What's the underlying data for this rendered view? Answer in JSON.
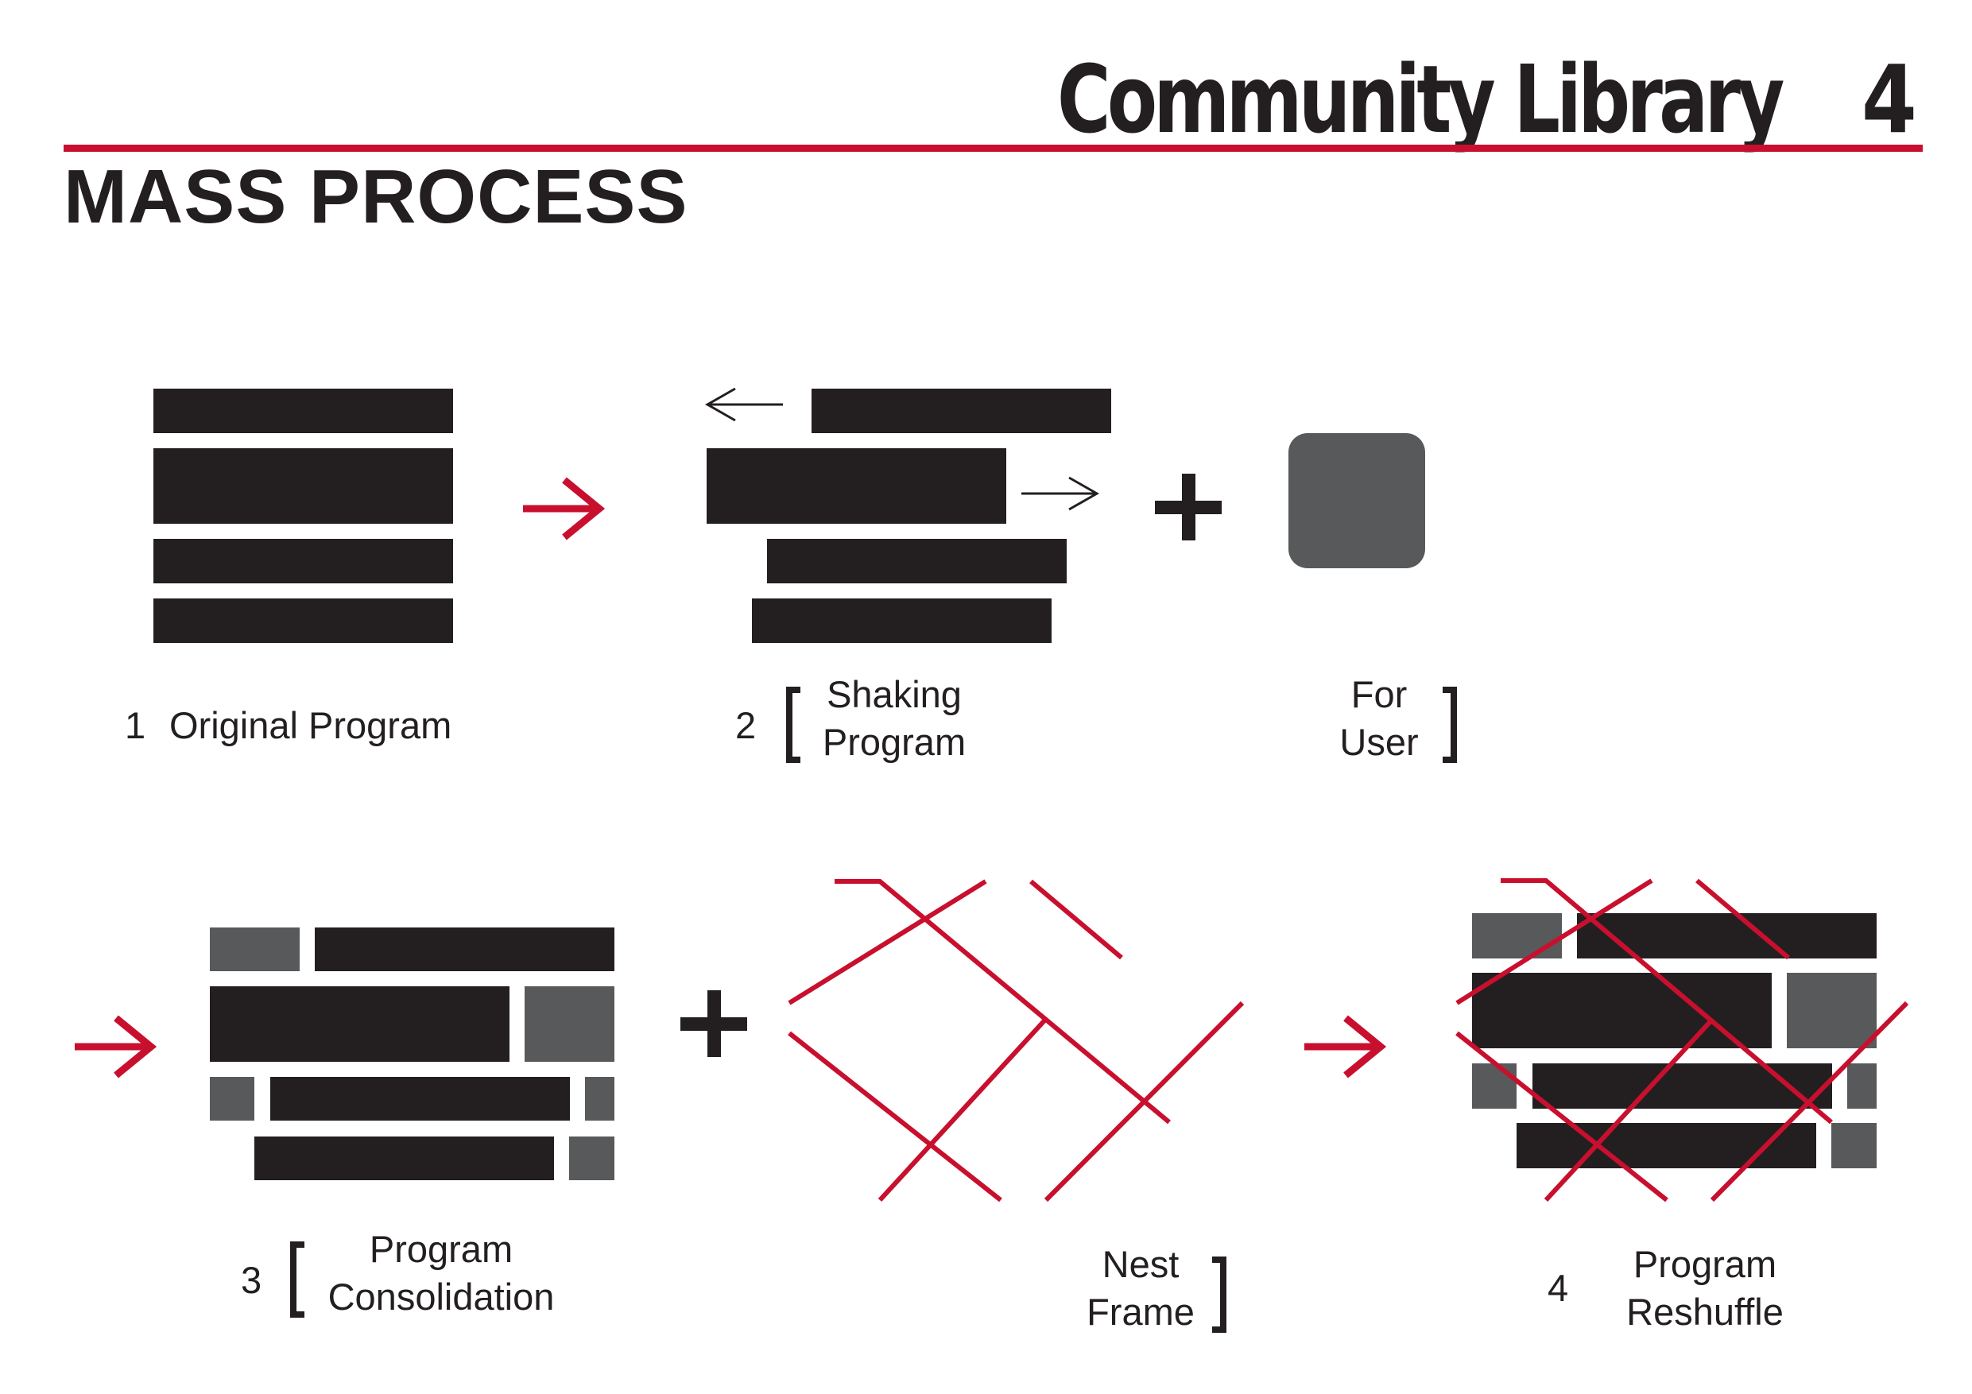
{
  "header": {
    "title": "Community Library",
    "page_number": "4"
  },
  "section_title": "MASS PROCESS",
  "colors": {
    "accent": "#c8102e",
    "program": "#231f20",
    "user": "#58595b",
    "background": "#ffffff"
  },
  "steps": [
    {
      "number": "1",
      "label": "Original Program"
    },
    {
      "number": "2",
      "label_line1": "Shaking",
      "label_line2": "Program"
    },
    {
      "label_line1": "For",
      "label_line2": "User"
    },
    {
      "number": "3",
      "label_line1": "Program",
      "label_line2": "Consolidation"
    },
    {
      "label_line1": "Nest",
      "label_line2": "Frame"
    },
    {
      "number": "4",
      "label_line1": "Program",
      "label_line2": "Reshuffle"
    }
  ],
  "icons": {
    "next_arrow": "arrow-right-icon",
    "plus": "plus-icon",
    "move_left": "arrow-left-icon",
    "move_right": "arrow-right-icon"
  }
}
